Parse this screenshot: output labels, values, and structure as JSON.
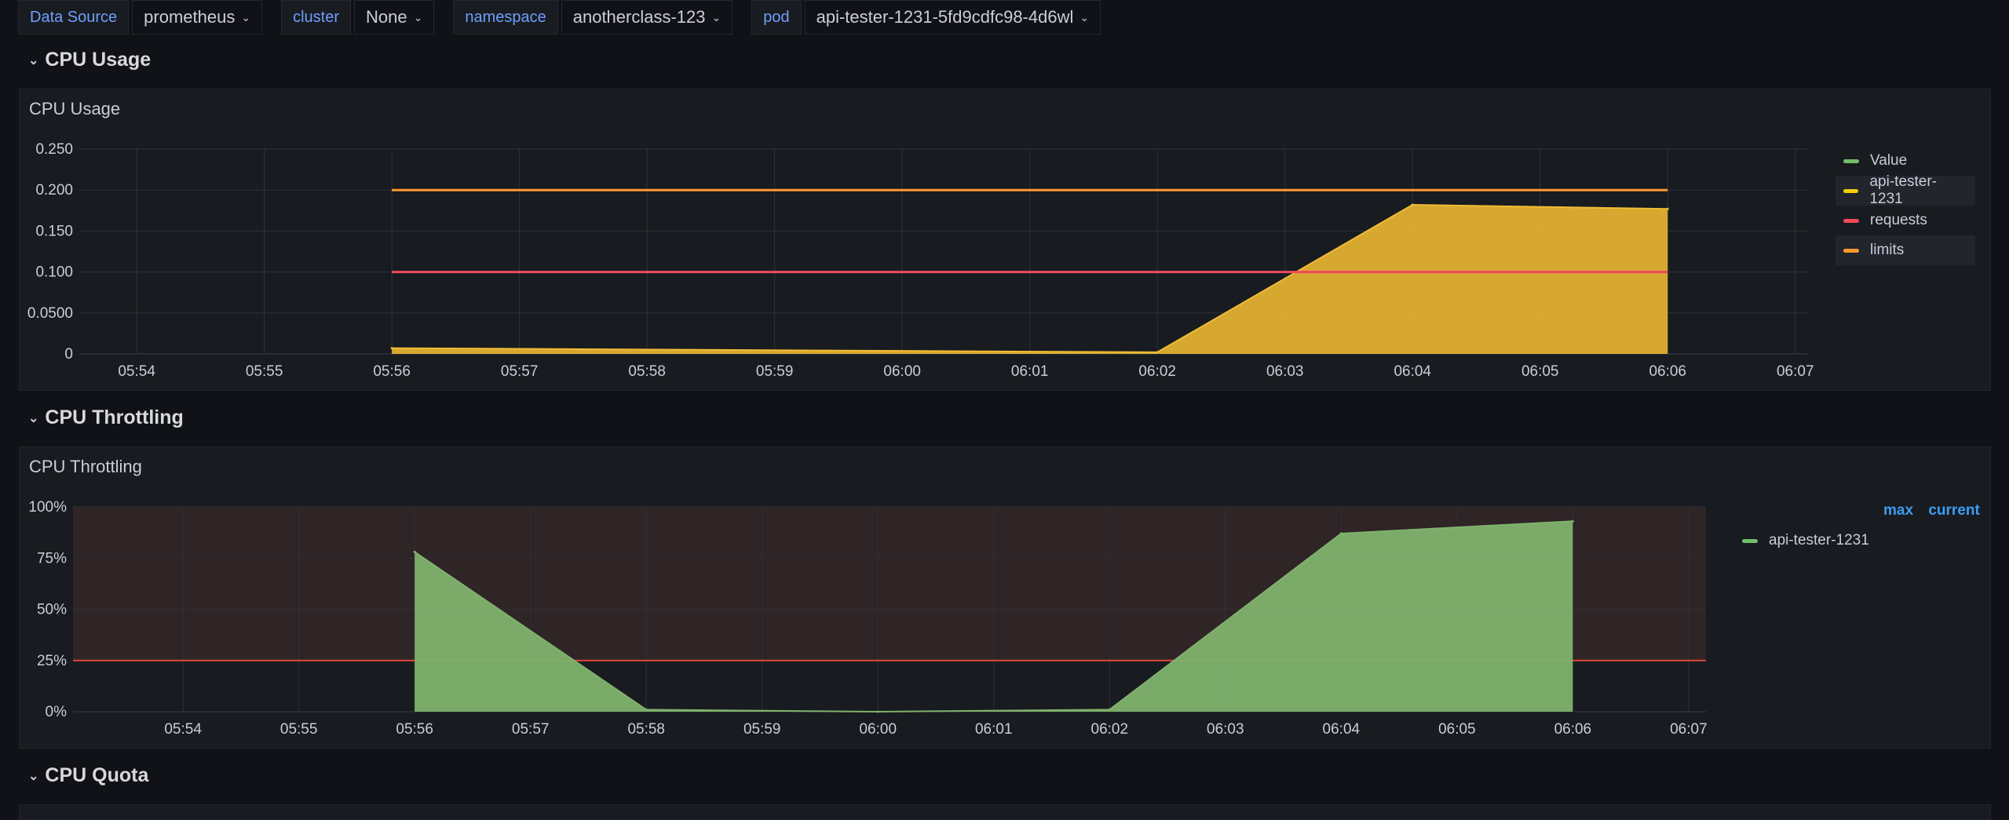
{
  "variables": [
    {
      "label": "Data Source",
      "value": "prometheus"
    },
    {
      "label": "cluster",
      "value": "None"
    },
    {
      "label": "namespace",
      "value": "anotherclass-123"
    },
    {
      "label": "pod",
      "value": "api-tester-1231-5fd9cdfc98-4d6wl"
    }
  ],
  "rows": {
    "cpu_usage": "CPU Usage",
    "cpu_throttling": "CPU Throttling",
    "cpu_quota": "CPU Quota"
  },
  "panels": {
    "usage": {
      "title": "CPU Usage",
      "legend": [
        {
          "name": "Value",
          "color": "#73bf69"
        },
        {
          "name": "api-tester-1231",
          "color": "#f2cc0c"
        },
        {
          "name": "requests",
          "color": "#f2495c"
        },
        {
          "name": "limits",
          "color": "#ff9830"
        }
      ]
    },
    "throttling": {
      "title": "CPU Throttling",
      "legend_headers": [
        "max",
        "current"
      ],
      "legend": [
        {
          "name": "api-tester-1231",
          "color": "#73bf69"
        }
      ]
    }
  },
  "chart_data": [
    {
      "type": "area",
      "title": "CPU Usage",
      "x": [
        "05:54",
        "05:55",
        "05:56",
        "05:57",
        "05:58",
        "05:59",
        "06:00",
        "06:01",
        "06:02",
        "06:03",
        "06:04",
        "06:05",
        "06:06",
        "06:07"
      ],
      "y_ticks": [
        "0.250",
        "0.200",
        "0.150",
        "0.100",
        "0.0500",
        "0"
      ],
      "ylim": [
        0,
        0.25
      ],
      "xlim": [
        "05:53.55",
        "06:07.1"
      ],
      "grid": true,
      "legend_position": "right",
      "series": [
        {
          "name": "api-tester-1231",
          "color": "#f2cc0c",
          "points": [
            [
              "05:56",
              0.007
            ],
            [
              "06:02",
              0.002
            ],
            [
              "06:04",
              0.182
            ],
            [
              "06:06",
              0.177
            ]
          ]
        },
        {
          "name": "requests",
          "color": "#f2495c",
          "points": [
            [
              "05:56",
              0.1
            ],
            [
              "06:06",
              0.1
            ]
          ]
        },
        {
          "name": "limits",
          "color": "#ff9830",
          "points": [
            [
              "05:56",
              0.2
            ],
            [
              "06:06",
              0.2
            ]
          ]
        }
      ]
    },
    {
      "type": "area",
      "title": "CPU Throttling",
      "x": [
        "05:54",
        "05:55",
        "05:56",
        "05:57",
        "05:58",
        "05:59",
        "06:00",
        "06:01",
        "06:02",
        "06:03",
        "06:04",
        "06:05",
        "06:06",
        "06:07"
      ],
      "y_ticks": [
        "100%",
        "75%",
        "50%",
        "25%",
        "0%"
      ],
      "ylim": [
        0,
        100
      ],
      "xlim": [
        "05:53.05",
        "06:07.15"
      ],
      "grid": true,
      "threshold": 25,
      "legend_position": "right",
      "series": [
        {
          "name": "api-tester-1231",
          "color": "#73bf69",
          "points": [
            [
              "05:56",
              78
            ],
            [
              "05:58",
              1
            ],
            [
              "06:00",
              0
            ],
            [
              "06:02",
              1
            ],
            [
              "06:04",
              87
            ],
            [
              "06:06",
              93
            ]
          ]
        }
      ]
    }
  ]
}
